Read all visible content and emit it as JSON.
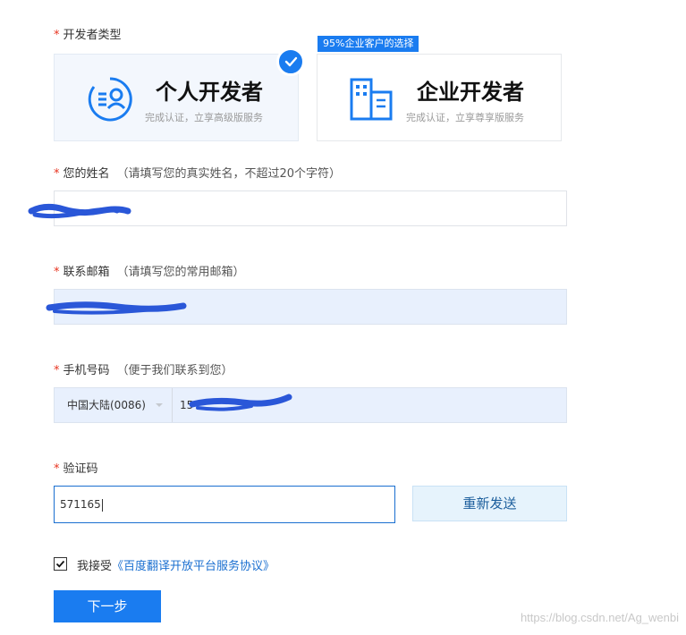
{
  "developer_type": {
    "label": "开发者类型",
    "badge": "95%企业客户的选择",
    "options": [
      {
        "title": "个人开发者",
        "subtitle": "完成认证，立享高级版服务",
        "selected": true
      },
      {
        "title": "企业开发者",
        "subtitle": "完成认证，立享尊享版服务",
        "selected": false
      }
    ]
  },
  "name_field": {
    "label": "您的姓名",
    "hint": "（请填写您的真实姓名，不超过20个字符）"
  },
  "email_field": {
    "label": "联系邮箱",
    "hint": "（请填写您的常用邮箱）"
  },
  "phone_field": {
    "label": "手机号码",
    "hint": "（便于我们联系到您）",
    "country": "中国大陆(0086)",
    "value_prefix": "15"
  },
  "code_field": {
    "label": "验证码",
    "value": "571165",
    "resend_label": "重新发送"
  },
  "agreement": {
    "text": "我接受",
    "link": "《百度翻译开放平台服务协议》",
    "checked": true
  },
  "next_button": "下一步",
  "watermark": "https://blog.csdn.net/Ag_wenbi",
  "colors": {
    "primary": "#1a7cf0",
    "required": "#e8331f",
    "redaction": "#2a57d8"
  }
}
